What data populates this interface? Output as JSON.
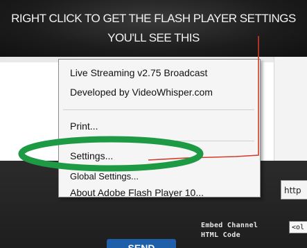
{
  "instruction": {
    "line1": "RIGHT CLICK TO GET THE FLASH PLAYER SETTINGS",
    "line2": "YOU'LL SEE THIS"
  },
  "context_menu": {
    "items": [
      {
        "label": "Live Streaming v2.75 Broadcast"
      },
      {
        "label": "Developed by VideoWhisper.com"
      },
      {
        "label": "Print..."
      },
      {
        "label": "Settings..."
      },
      {
        "label": "Global Settings..."
      },
      {
        "label": "About Adobe Flash Player 10..."
      }
    ],
    "highlighted_item": "Settings..."
  },
  "background": {
    "url_field_value": "http",
    "embed_label_line1": "Embed Channel",
    "embed_label_line2": "HTML Code",
    "embed_field_value": "<ol",
    "send_button_label": "SEND"
  },
  "annotation_colors": {
    "ellipse": "#1e9a45",
    "arrow_line": "#d23a2a"
  }
}
